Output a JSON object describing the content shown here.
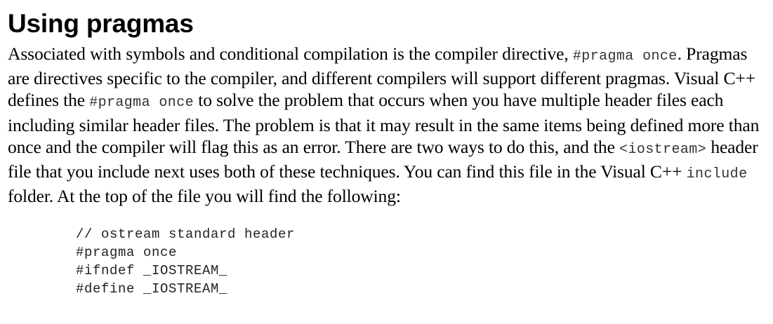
{
  "section": {
    "heading": "Using pragmas"
  },
  "paragraph": {
    "part1": "Associated with symbols and conditional compilation is the compiler directive, ",
    "code1": "#pragma once",
    "part2": ". Pragmas are directives specific to the compiler, and different compilers will support different pragmas. Visual C++ defines the ",
    "code2": "#pragma once",
    "part3": " to solve the problem that occurs when you have multiple header files each including similar header files. The problem is that it may result in the same items being defined more than once and the compiler will flag this as an error. There are two ways to do this, and the ",
    "code3": "<iostream>",
    "part4": " header file that you include next uses both of these techniques. You can find this file in the Visual C++ ",
    "code4": "include",
    "part5": " folder. At the top of the file you will find the following:"
  },
  "code_block": {
    "lines": [
      "// ostream standard header",
      "#pragma once",
      "#ifndef _IOSTREAM_",
      "#define _IOSTREAM_"
    ]
  }
}
